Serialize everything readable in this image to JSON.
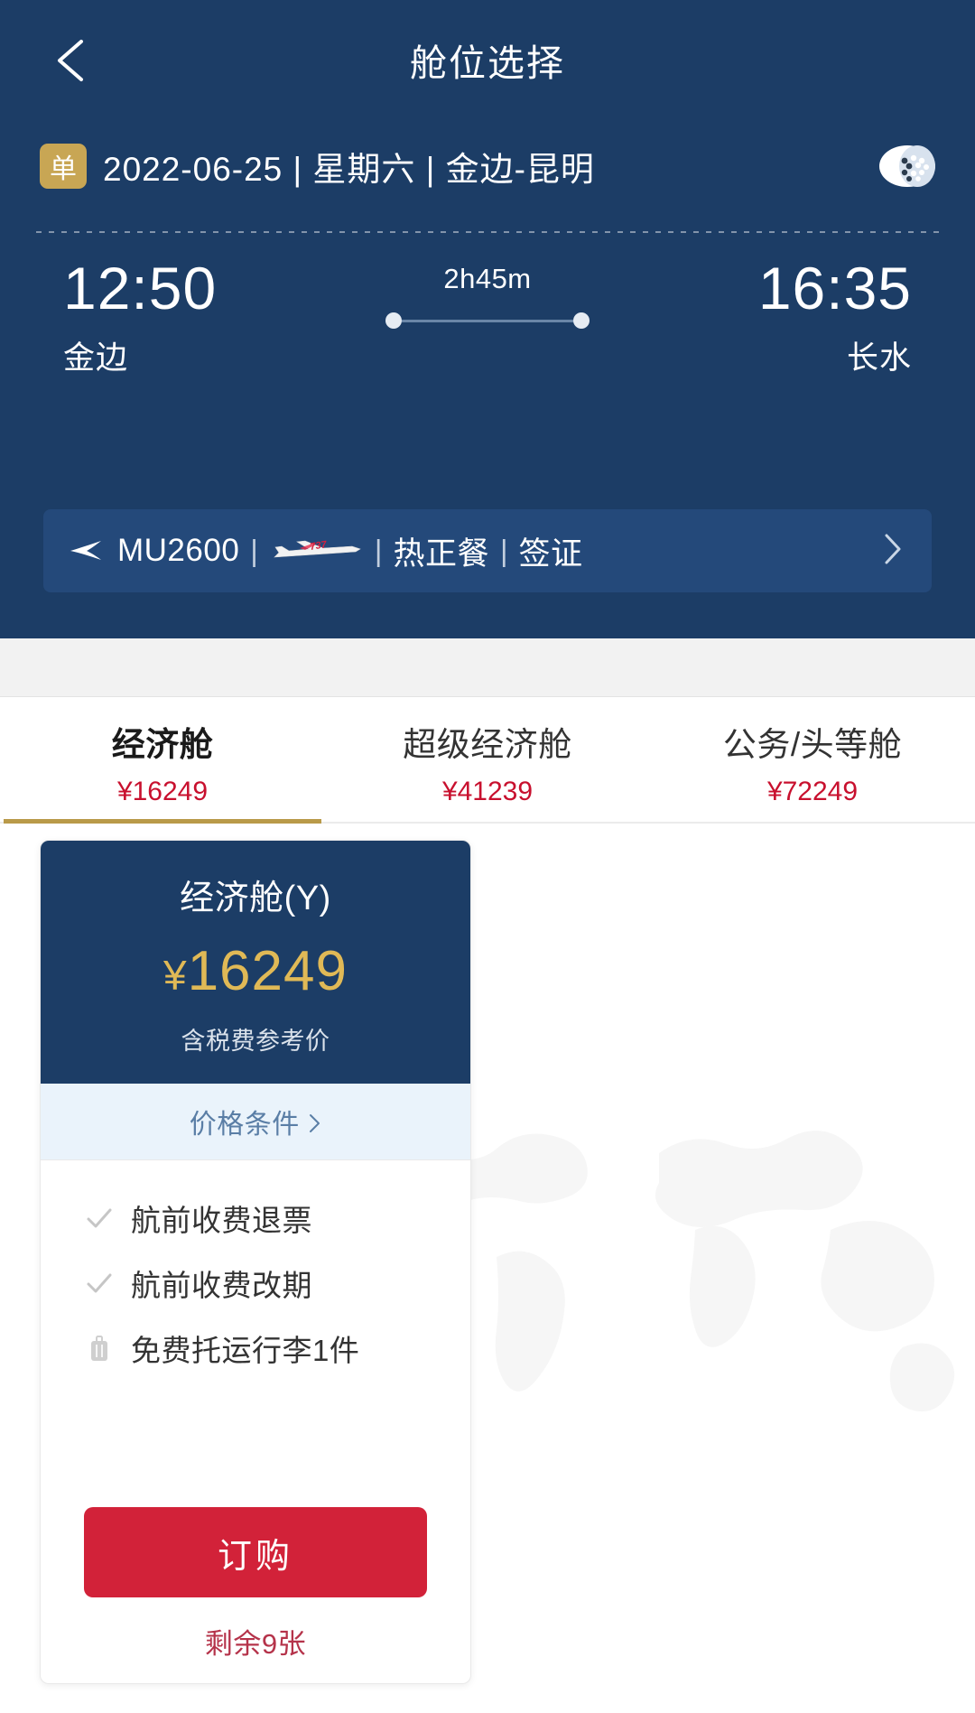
{
  "nav": {
    "title": "舱位选择",
    "back_icon": "chevron-left-icon"
  },
  "trip": {
    "badge": "单",
    "summary": "2022-06-25 | 星期六 | 金边-昆明",
    "scan_icon": "scan-icon"
  },
  "itinerary": {
    "departure_time": "12:50",
    "departure_airport": "金边",
    "arrival_time": "16:35",
    "arrival_airport": "长水",
    "duration": "2h45m"
  },
  "flight": {
    "airline_icon": "china-eastern-logo-icon",
    "number": "MU2600",
    "sep1": "|",
    "aircraft_icon": "aircraft-737-icon",
    "sep2": "|",
    "meal": "热正餐",
    "sep3": "|",
    "visa": "签证",
    "chevron_icon": "chevron-right-icon"
  },
  "tabs": [
    {
      "label": "经济舱",
      "price": "¥16249",
      "active": true
    },
    {
      "label": "超级经济舱",
      "price": "¥41239",
      "active": false
    },
    {
      "label": "公务/头等舱",
      "price": "¥72249",
      "active": false
    }
  ],
  "fare_card": {
    "cabin": "经济舱(Y)",
    "currency": "¥",
    "price": "16249",
    "price_note": "含税费参考价",
    "conditions_label": "价格条件",
    "conditions_chevron_icon": "chevron-right-icon",
    "benefits": [
      {
        "icon": "check-icon",
        "text": "航前收费退票"
      },
      {
        "icon": "check-icon",
        "text": "航前收费改期"
      },
      {
        "icon": "luggage-icon",
        "text": "免费托运行李1件"
      }
    ],
    "order_button": "订购",
    "remaining": "剩余9张"
  },
  "colors": {
    "header_blue": "#1c3d66",
    "accent_gold": "#c8a654",
    "price_red": "#c8102e",
    "order_red": "#d22239",
    "fare_price_gold": "#e0b956",
    "tab_underline": "#b99a49"
  }
}
